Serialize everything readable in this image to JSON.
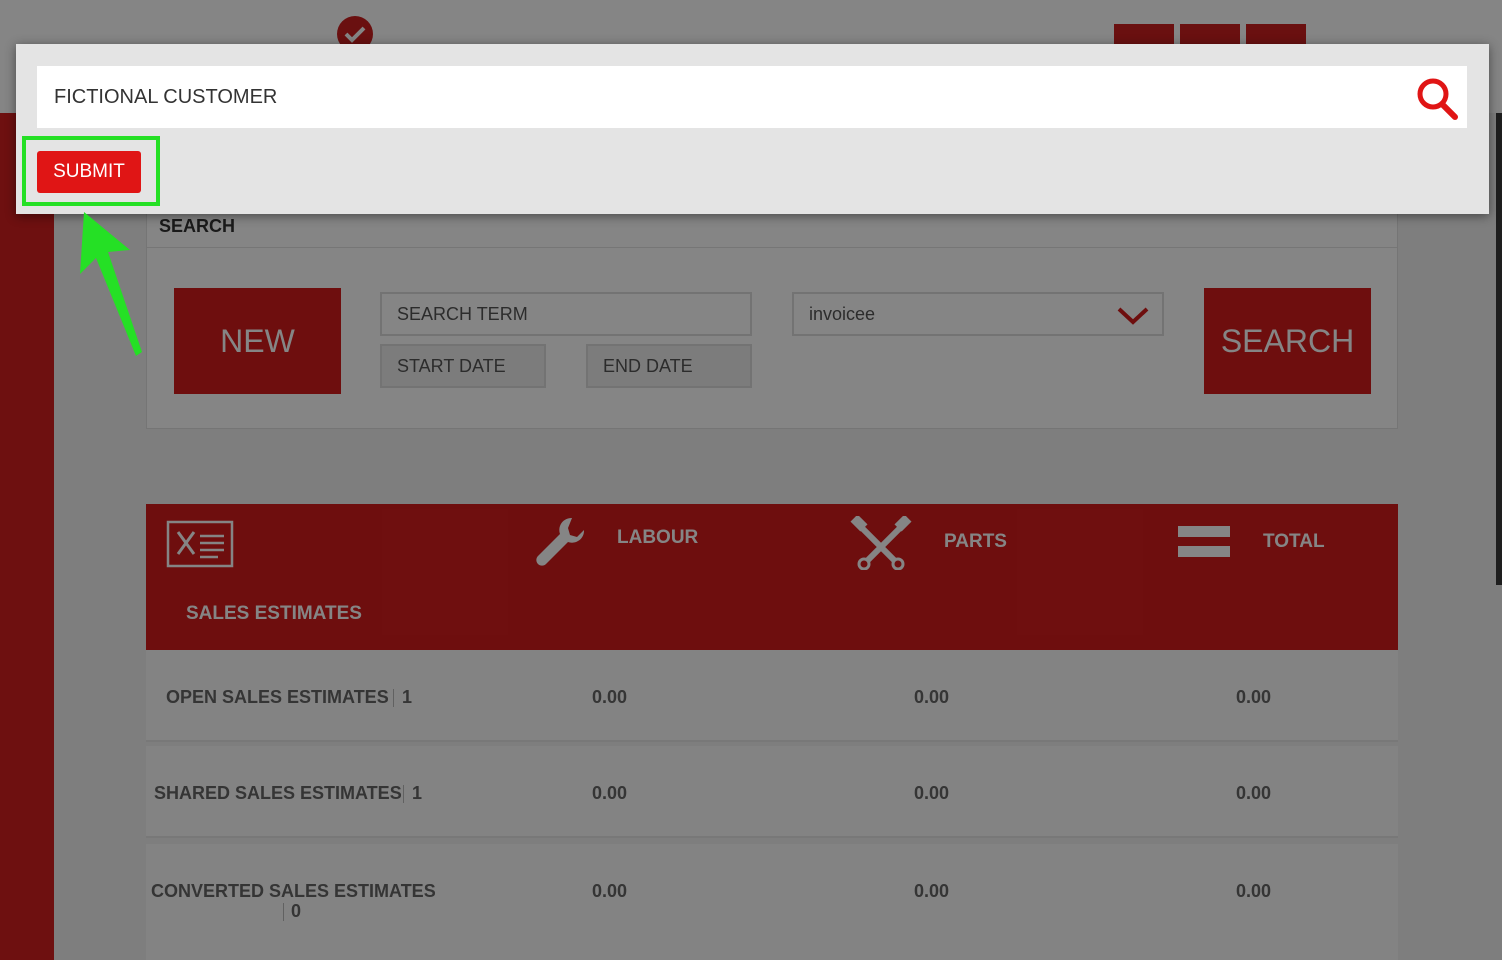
{
  "search_panel": {
    "title": "SEARCH",
    "new_label": "NEW",
    "search_term_placeholder": "SEARCH TERM",
    "start_date_placeholder": "START DATE",
    "end_date_placeholder": "END DATE",
    "type_select_value": "invoicee",
    "search_label": "SEARCH"
  },
  "summary": {
    "section_title": "SALES ESTIMATES",
    "columns": {
      "labour": "LABOUR",
      "parts": "PARTS",
      "total": "TOTAL"
    },
    "rows": [
      {
        "name": "OPEN SALES ESTIMATES",
        "count": "1",
        "labour": "0.00",
        "parts": "0.00",
        "total": "0.00"
      },
      {
        "name": "SHARED SALES ESTIMATES",
        "count": "1",
        "labour": "0.00",
        "parts": "0.00",
        "total": "0.00"
      },
      {
        "name": "CONVERTED SALES ESTIMATES",
        "count": "0",
        "labour": "0.00",
        "parts": "0.00",
        "total": "0.00"
      }
    ]
  },
  "modal": {
    "search_value": "FICTIONAL CUSTOMER",
    "submit_label": "SUBMIT"
  },
  "icons": {
    "header_check": "check-circle-icon",
    "modal_search": "search-icon",
    "labour": "wrench-icon",
    "parts": "crossed-pistons-icon",
    "total": "equals-icon",
    "sales_estimates": "estimate-document-icon",
    "select_caret": "chevron-down-icon",
    "annotation": "arrow-pointer-icon"
  },
  "colors": {
    "brand_red": "#d41c1c",
    "submit_red": "#e01515",
    "highlight_green": "#25e025"
  }
}
